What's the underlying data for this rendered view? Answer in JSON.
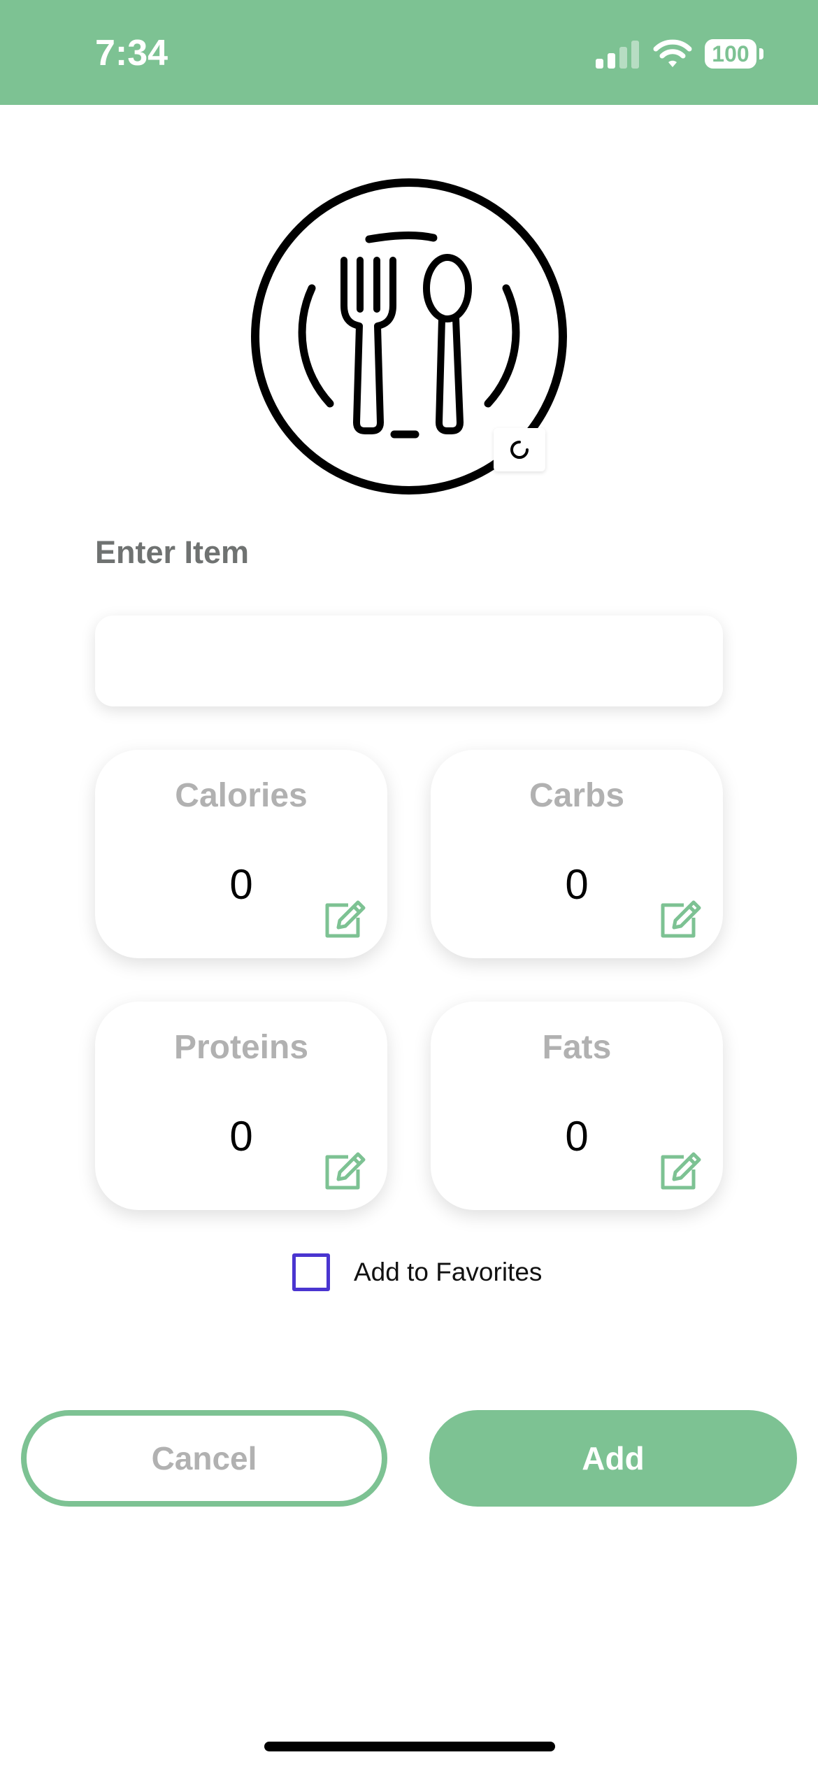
{
  "status_bar": {
    "time": "7:34",
    "battery": "100",
    "signal_icon": "cellular-signal-icon",
    "wifi_icon": "wifi-icon",
    "background_color": "#7dc293"
  },
  "logo": {
    "icon": "plate-fork-spoon-icon",
    "camera_icon": "camera-icon"
  },
  "form": {
    "item_label": "Enter Item",
    "item_value": "",
    "item_placeholder": ""
  },
  "macros": {
    "calories": {
      "label": "Calories",
      "value": "0"
    },
    "carbs": {
      "label": "Carbs",
      "value": "0"
    },
    "proteins": {
      "label": "Proteins",
      "value": "0"
    },
    "fats": {
      "label": "Fats",
      "value": "0"
    },
    "edit_icon": "edit-icon"
  },
  "favorites": {
    "label": "Add to Favorites",
    "checked": false
  },
  "actions": {
    "cancel_label": "Cancel",
    "add_label": "Add"
  },
  "colors": {
    "accent": "#7dc293",
    "muted_text": "#b1b1b1",
    "checkbox": "#4a35d0"
  }
}
